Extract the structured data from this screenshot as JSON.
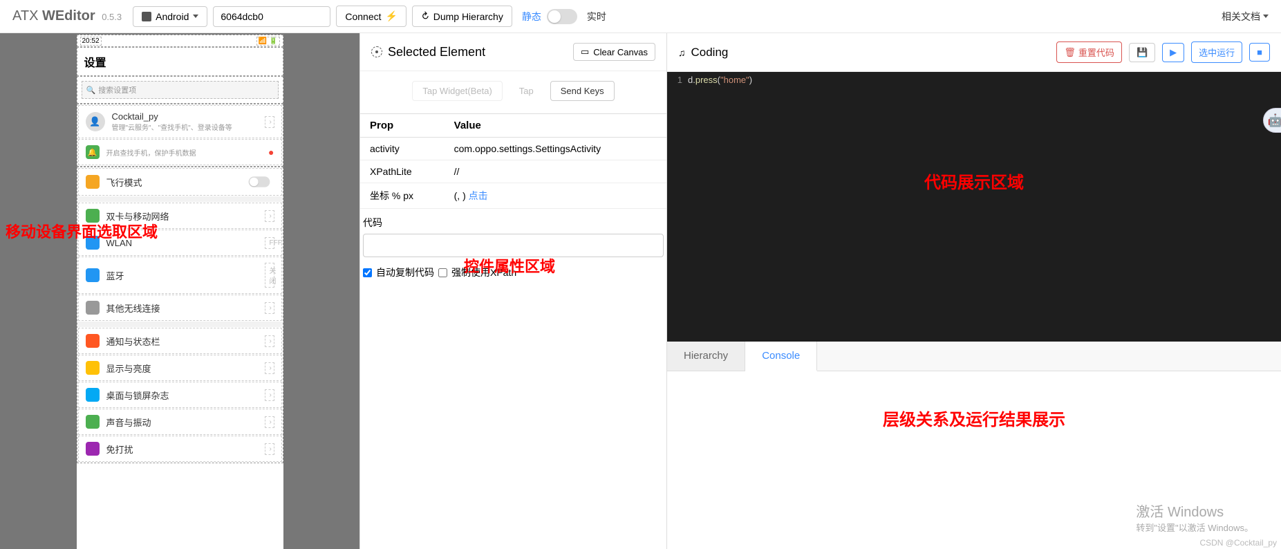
{
  "brand": {
    "prefix": "ATX ",
    "name": "WEditor",
    "version": "0.5.3"
  },
  "toolbar": {
    "platform": "Android",
    "device_id": "6064dcb0",
    "connect": "Connect",
    "dump": "Dump Hierarchy",
    "static_label": "静态",
    "realtime_label": "实时",
    "docs": "相关文档"
  },
  "phone": {
    "time": "20:52",
    "title": "设置",
    "search_placeholder": "搜索设置项",
    "account": {
      "name": "Cocktail_py",
      "sub": "管理\"云服务\"、\"查找手机\"、登录设备等"
    },
    "security": "开启查找手机，保护手机数据",
    "items": [
      {
        "label": "飞行模式",
        "icon_color": "#f5a623",
        "right": "toggle"
      },
      {
        "label": "双卡与移动网络",
        "icon_color": "#4caf50",
        "right": "arrow"
      },
      {
        "label": "WLAN",
        "icon_color": "#2196f3",
        "right": "FFF"
      },
      {
        "label": "蓝牙",
        "icon_color": "#2196f3",
        "right": "关闭"
      },
      {
        "label": "其他无线连接",
        "icon_color": "#999",
        "right": "arrow"
      },
      {
        "label": "通知与状态栏",
        "icon_color": "#ff5722",
        "right": "arrow"
      },
      {
        "label": "显示与亮度",
        "icon_color": "#ffc107",
        "right": "arrow"
      },
      {
        "label": "桌面与锁屏杂志",
        "icon_color": "#03a9f4",
        "right": "arrow"
      },
      {
        "label": "声音与振动",
        "icon_color": "#4caf50",
        "right": "arrow"
      },
      {
        "label": "免打扰",
        "icon_color": "#9c27b0",
        "right": "arrow"
      }
    ]
  },
  "annotations": {
    "left": "移动设备界面选取区域",
    "mid": "控件属性区域",
    "code": "代码展示区域",
    "console": "层级关系及运行结果展示"
  },
  "selected": {
    "title": "Selected Element",
    "clear": "Clear Canvas",
    "actions": {
      "tap_widget": "Tap Widget(Beta)",
      "tap": "Tap",
      "send_keys": "Send Keys"
    },
    "headers": {
      "prop": "Prop",
      "value": "Value"
    },
    "rows": [
      {
        "prop": "activity",
        "value": "com.oppo.settings.SettingsActivity"
      },
      {
        "prop": "XPathLite",
        "value": "//"
      },
      {
        "prop": "坐标 % px",
        "value": "(, ) ",
        "link": "点击"
      }
    ],
    "code_label": "代码",
    "auto_copy": "自动复制代码",
    "force_xpath": "强制使用XPath"
  },
  "coding": {
    "title": "Coding",
    "reset": "重置代码",
    "save_icon": "💾",
    "play_icon": "▶",
    "run_selected": "选中运行",
    "stop_icon": "■",
    "code_line": {
      "obj": "d",
      "method": "press",
      "arg": "\"home\""
    }
  },
  "tabs": {
    "hierarchy": "Hierarchy",
    "console": "Console"
  },
  "watermark": {
    "title": "激活 Windows",
    "sub": "转到\"设置\"以激活 Windows。"
  },
  "credit": "CSDN @Cocktail_py"
}
